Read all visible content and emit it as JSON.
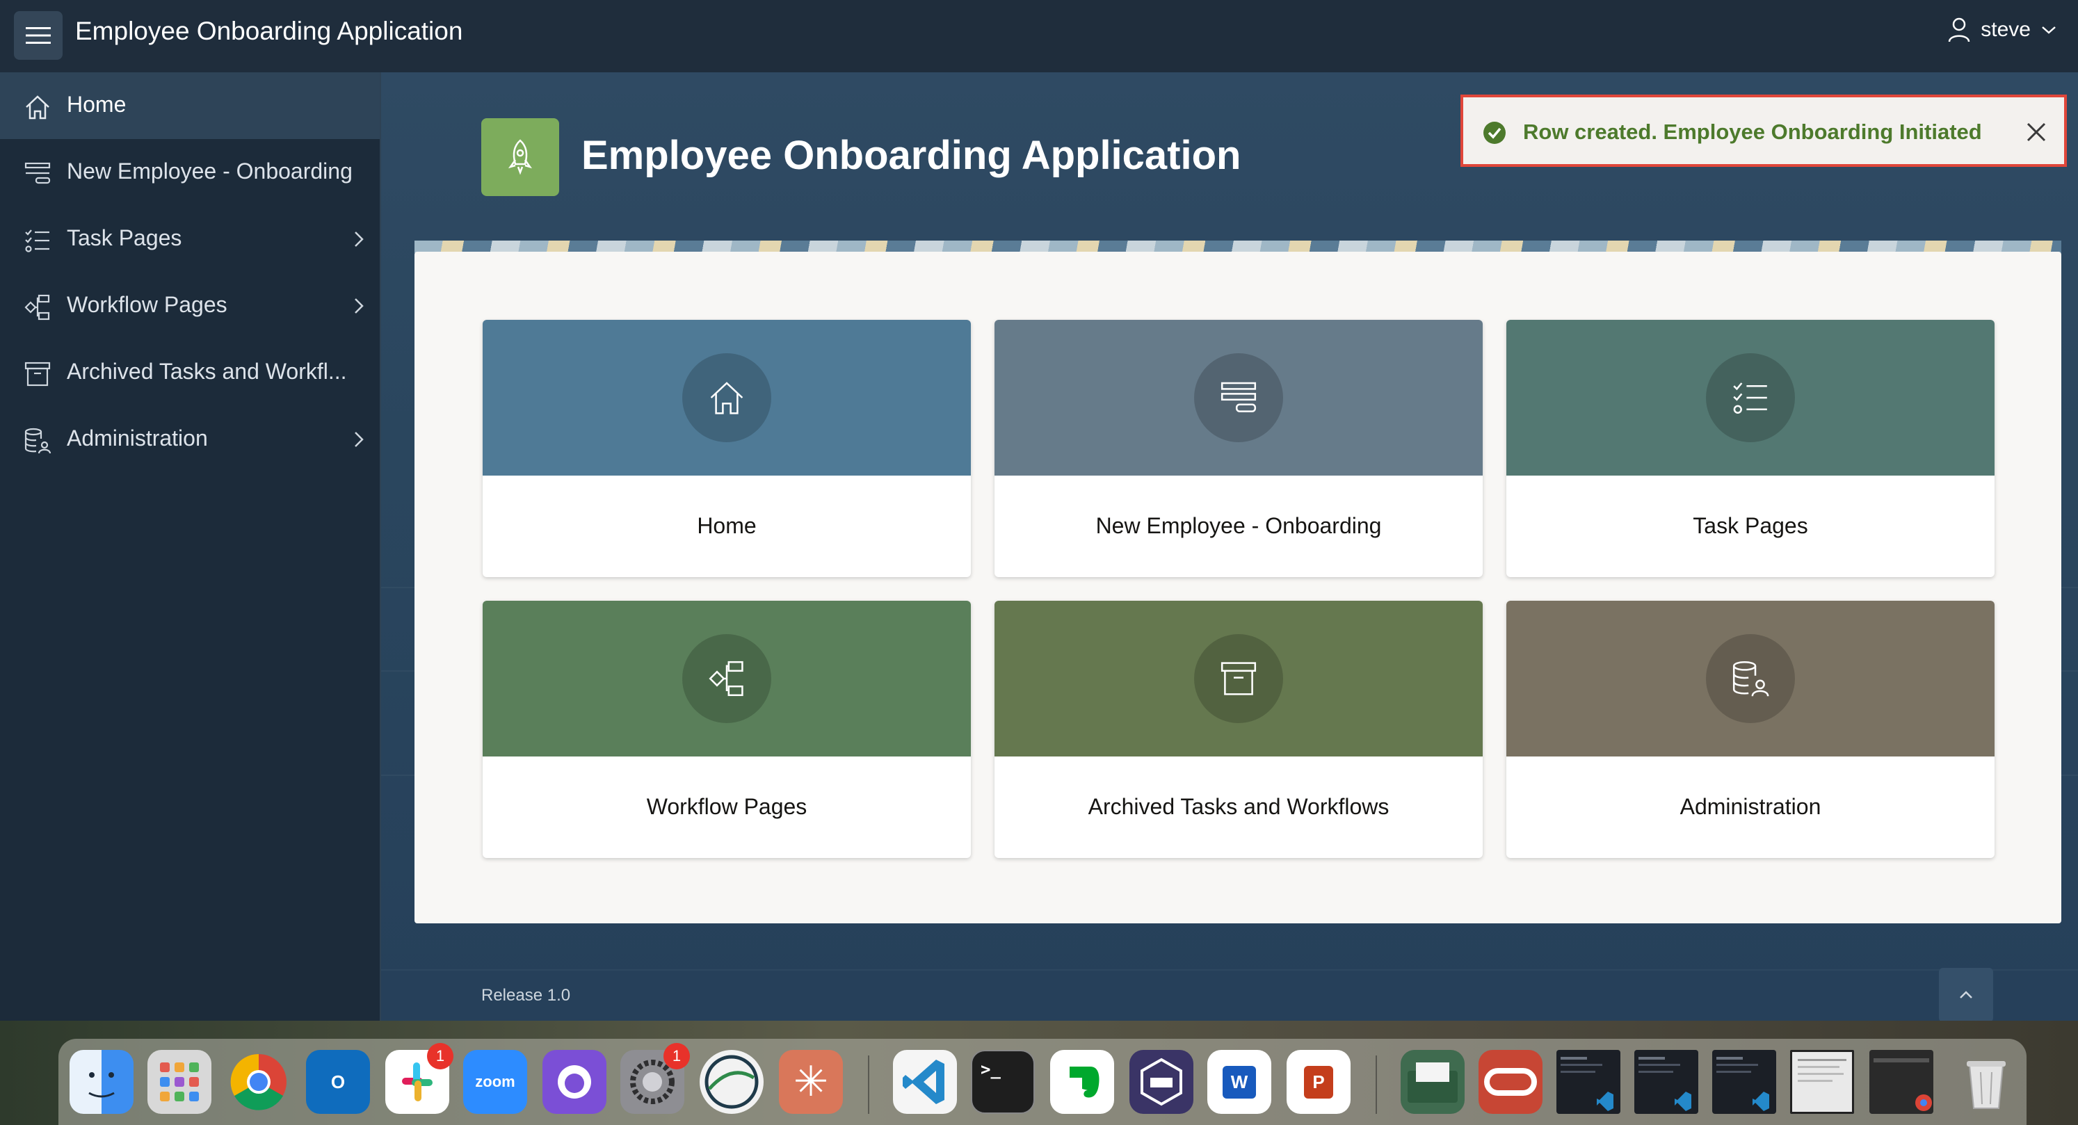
{
  "header": {
    "app_title": "Employee Onboarding Application",
    "user_name": "steve"
  },
  "sidebar": {
    "items": [
      {
        "label": "Home",
        "icon": "home-icon",
        "active": true
      },
      {
        "label": "New Employee - Onboarding",
        "icon": "form-icon"
      },
      {
        "label": "Task Pages",
        "icon": "checklist-icon",
        "has_children": true
      },
      {
        "label": "Workflow Pages",
        "icon": "workflow-icon",
        "has_children": true
      },
      {
        "label": "Archived Tasks and Workfl...",
        "icon": "archive-icon"
      },
      {
        "label": "Administration",
        "icon": "database-user-icon",
        "has_children": true
      }
    ]
  },
  "hero": {
    "title": "Employee Onboarding Application",
    "icon": "rocket-icon",
    "icon_color": "#7dac5c"
  },
  "toast": {
    "message": "Row created. Employee Onboarding Initiated",
    "type": "success",
    "color": "#4d7a2c"
  },
  "cards": [
    {
      "label": "Home",
      "icon": "home-icon",
      "color": "#4f7a96"
    },
    {
      "label": "New Employee - Onboarding",
      "icon": "form-icon",
      "color": "#667b8a"
    },
    {
      "label": "Task Pages",
      "icon": "checklist-icon",
      "color": "#537872"
    },
    {
      "label": "Workflow Pages",
      "icon": "workflow-icon",
      "color": "#5a7f5a"
    },
    {
      "label": "Archived Tasks and Workflows",
      "icon": "archive-icon",
      "color": "#65784f"
    },
    {
      "label": "Administration",
      "icon": "database-user-icon",
      "color": "#7a7262"
    }
  ],
  "footer": {
    "release": "Release 1.0"
  },
  "dock": {
    "apps": [
      {
        "name": "Finder",
        "icon": "finder-icon",
        "color": "#3d8ef0"
      },
      {
        "name": "Launchpad",
        "icon": "launchpad-icon",
        "color": "#d8d8d8"
      },
      {
        "name": "Chrome",
        "icon": "chrome-icon",
        "color": "#ffffff"
      },
      {
        "name": "Outlook",
        "icon": "outlook-icon",
        "color": "#0f6cbd"
      },
      {
        "name": "Slack",
        "icon": "slack-icon",
        "color": "#ffffff",
        "badge": "1"
      },
      {
        "name": "Zoom",
        "icon": "zoom-icon",
        "color": "#2d8cff",
        "text": "zoom"
      },
      {
        "name": "GitHub Desktop",
        "icon": "github-icon",
        "color": "#7b4fd6"
      },
      {
        "name": "System Settings",
        "icon": "settings-icon",
        "color": "#8e8e93",
        "badge": "1"
      },
      {
        "name": "Browser",
        "icon": "globe-icon",
        "color": "#f2f2f2"
      },
      {
        "name": "Claude",
        "icon": "sparkle-icon",
        "color": "#d9775a"
      },
      {
        "name": "VS Code",
        "icon": "vscode-icon",
        "color": "#f5f5f5"
      },
      {
        "name": "Terminal",
        "icon": "terminal-icon",
        "color": "#1e1e1e"
      },
      {
        "name": "Evernote",
        "icon": "evernote-icon",
        "color": "#ffffff"
      },
      {
        "name": "Docker",
        "icon": "container-icon",
        "color": "#3a3466"
      },
      {
        "name": "Word",
        "icon": "word-icon",
        "color": "#ffffff"
      },
      {
        "name": "PowerPoint",
        "icon": "powerpoint-icon",
        "color": "#ffffff"
      },
      {
        "name": "Folder",
        "icon": "folder-icon",
        "color": "#3f6b4f"
      },
      {
        "name": "Oracle",
        "icon": "oracle-icon",
        "color": "#c74634"
      },
      {
        "name": "VS Code Window 1",
        "icon": "window-thumbnail-icon",
        "color": "#1b1f26"
      },
      {
        "name": "VS Code Window 2",
        "icon": "window-thumbnail-icon",
        "color": "#1b1f26"
      },
      {
        "name": "VS Code Window 3",
        "icon": "window-thumbnail-icon",
        "color": "#1b1f26"
      },
      {
        "name": "Document Window",
        "icon": "window-thumbnail-icon",
        "color": "#e9e9e9"
      },
      {
        "name": "Chrome Window",
        "icon": "window-thumbnail-icon",
        "color": "#2a2a2a"
      },
      {
        "name": "Trash",
        "icon": "trash-icon",
        "color": "#d5d5d5"
      }
    ]
  }
}
